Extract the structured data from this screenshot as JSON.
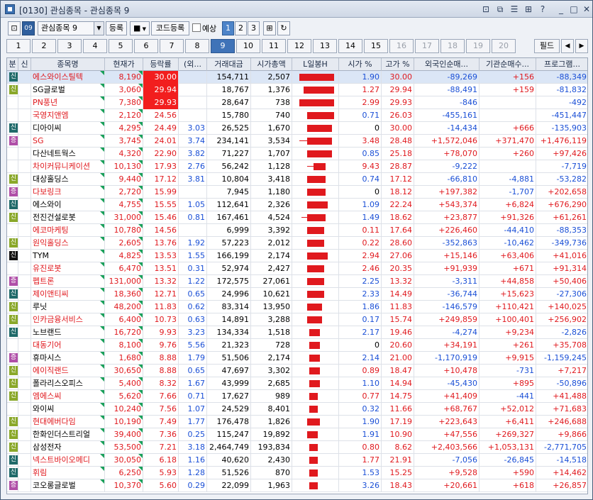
{
  "window": {
    "title": "[0130] 관심종목 - 관심종목 9",
    "buttons": [
      "⊡",
      "⧉",
      "☰",
      "⊞",
      "?",
      "_",
      "□",
      "✕"
    ]
  },
  "toolbar": {
    "icon1": "⊡",
    "icon2": "09",
    "group_value": "관심종목 9",
    "register_label": "등록",
    "square_icon": "■",
    "code_register_label": "코드등록",
    "yesang_label": "예상",
    "pages": [
      "1",
      "2",
      "3"
    ],
    "selected_page": "1",
    "tool_icon": "⊞",
    "refresh_icon": "↻"
  },
  "tabs": {
    "items": [
      "1",
      "2",
      "3",
      "4",
      "5",
      "6",
      "7",
      "8",
      "9",
      "10",
      "11",
      "12",
      "13",
      "14",
      "15",
      "16",
      "17",
      "18",
      "19",
      "20"
    ],
    "selected": "9",
    "dimmed_from": 16,
    "filter_label": "필드",
    "prev": "◀",
    "next": "▶"
  },
  "grid": {
    "headers": [
      "분",
      "신",
      "종목명",
      "현재가",
      "등락률",
      "(외...",
      "거래대금",
      "시가총액",
      "L일봉H",
      "시가 %",
      "고가 %",
      "외국인순매...",
      "기관순매수...",
      "프로그램..."
    ],
    "badge_colors": {
      "신": "#1f6a6a",
      "증": "#b04fa8",
      "신2": "#8aa82a",
      "신3": "#111111"
    },
    "rows": [
      {
        "badge": "신",
        "bt": "t",
        "name": "에스와이스틸텍",
        "nr": true,
        "price": "8,190",
        "rate": "30.00",
        "hot": true,
        "fr": "",
        "amt": "154,711",
        "cap": "2,507",
        "c": [
          0.15,
          0.95,
          0.1,
          0.95
        ],
        "open": "1.90",
        "od": "dn",
        "high": "30.00",
        "frn": "-89,269",
        "fd": "dn",
        "inst": "+156",
        "id": "up",
        "prog": "-88,349",
        "pd": "dn",
        "hl": true
      },
      {
        "badge": "신",
        "bt": "g",
        "name": "SG글로벌",
        "nr": false,
        "price": "3,060",
        "rate": "29.94",
        "hot": true,
        "fr": "",
        "amt": "18,767",
        "cap": "1,376",
        "c": [
          0.25,
          0.95,
          0.2,
          0.95
        ],
        "open": "1.27",
        "od": "up",
        "high": "29.94",
        "frn": "-88,491",
        "fd": "dn",
        "inst": "+159",
        "id": "up",
        "prog": "-81,832",
        "pd": "dn"
      },
      {
        "badge": "",
        "bt": "",
        "name": "PN풍년",
        "nr": true,
        "price": "7,380",
        "rate": "29.93",
        "hot": true,
        "fr": "",
        "amt": "28,647",
        "cap": "738",
        "c": [
          0.2,
          0.95,
          0.1,
          0.95
        ],
        "open": "2.99",
        "od": "up",
        "high": "29.93",
        "frn": "-846",
        "fd": "dn",
        "inst": "",
        "id": "up",
        "prog": "-492",
        "pd": "dn"
      },
      {
        "badge": "",
        "bt": "",
        "name": "국영지앤엠",
        "nr": true,
        "price": "2,120",
        "rate": "24.56",
        "hot": false,
        "fr": "",
        "amt": "15,780",
        "cap": "740",
        "c": [
          0.3,
          0.85,
          0.3,
          0.95
        ],
        "open": "0.71",
        "od": "dn",
        "high": "26.03",
        "frn": "-455,161",
        "fd": "dn",
        "inst": "",
        "id": "up",
        "prog": "-451,447",
        "pd": "dn"
      },
      {
        "badge": "신",
        "bt": "t",
        "name": "디아이씨",
        "nr": false,
        "price": "4,295",
        "rate": "24.49",
        "hot": false,
        "fr": "3.03",
        "amt": "26,525",
        "cap": "1,670",
        "c": [
          0.3,
          0.8,
          0.3,
          0.9
        ],
        "open": "0",
        "od": "blk",
        "high": "30.00",
        "frn": "-14,434",
        "fd": "dn",
        "inst": "+666",
        "id": "up",
        "prog": "-135,903",
        "pd": "dn"
      },
      {
        "badge": "증",
        "bt": "p",
        "name": "SG",
        "nr": true,
        "price": "3,745",
        "rate": "24.01",
        "hot": false,
        "fr": "3.74",
        "amt": "234,141",
        "cap": "3,534",
        "c": [
          0.1,
          0.8,
          0.3,
          0.9
        ],
        "open": "3.48",
        "od": "up",
        "high": "28.48",
        "frn": "+1,572,046",
        "fd": "up",
        "inst": "+371,470",
        "id": "up",
        "prog": "+1,476,119",
        "pd": "up"
      },
      {
        "badge": "",
        "bt": "",
        "name": "다산네트웍스",
        "nr": false,
        "price": "4,320",
        "rate": "22.90",
        "hot": false,
        "fr": "3.82",
        "amt": "71,227",
        "cap": "1,707",
        "c": [
          0.3,
          0.8,
          0.3,
          0.9
        ],
        "open": "0.85",
        "od": "dn",
        "high": "25.18",
        "frn": "+78,070",
        "fd": "up",
        "inst": "+260",
        "id": "up",
        "prog": "+97,426",
        "pd": "up"
      },
      {
        "badge": "",
        "bt": "",
        "name": "차이커뮤니케이션",
        "nr": true,
        "price": "10,130",
        "rate": "17.93",
        "hot": false,
        "fr": "2.76",
        "amt": "56,242",
        "cap": "1,128",
        "c": [
          0.3,
          0.6,
          0.45,
          0.75
        ],
        "open": "9.43",
        "od": "up",
        "high": "28.87",
        "frn": "-9,222",
        "fd": "dn",
        "inst": "",
        "id": "up",
        "prog": "-7,719",
        "pd": "dn"
      },
      {
        "badge": "신",
        "bt": "g",
        "name": "대상홀딩스",
        "nr": false,
        "price": "9,440",
        "rate": "17.12",
        "hot": false,
        "fr": "3.81",
        "amt": "10,804",
        "cap": "3,418",
        "c": [
          0.3,
          0.65,
          0.3,
          0.75
        ],
        "open": "0.74",
        "od": "dn",
        "high": "17.12",
        "frn": "-66,810",
        "fd": "dn",
        "inst": "-4,881",
        "id": "dn",
        "prog": "-53,282",
        "pd": "dn"
      },
      {
        "badge": "증",
        "bt": "p",
        "name": "다보링크",
        "nr": true,
        "price": "2,720",
        "rate": "15.99",
        "hot": false,
        "fr": "",
        "amt": "7,945",
        "cap": "1,180",
        "c": [
          0.3,
          0.65,
          0.3,
          0.75
        ],
        "open": "0",
        "od": "blk",
        "high": "18.12",
        "frn": "+197,382",
        "fd": "up",
        "inst": "-1,707",
        "id": "dn",
        "prog": "+202,658",
        "pd": "up"
      },
      {
        "badge": "신",
        "bt": "t",
        "name": "에스와이",
        "nr": false,
        "price": "4,755",
        "rate": "15.55",
        "hot": false,
        "fr": "1.05",
        "amt": "112,641",
        "cap": "2,326",
        "c": [
          0.3,
          0.7,
          0.3,
          0.8
        ],
        "open": "1.09",
        "od": "dn",
        "high": "22.24",
        "frn": "+543,374",
        "fd": "up",
        "inst": "+6,824",
        "id": "up",
        "prog": "+676,290",
        "pd": "up"
      },
      {
        "badge": "신",
        "bt": "g",
        "name": "전진건설로봇",
        "nr": false,
        "price": "31,000",
        "rate": "15.46",
        "hot": false,
        "fr": "0.81",
        "amt": "167,461",
        "cap": "4,524",
        "c": [
          0.15,
          0.65,
          0.3,
          0.75
        ],
        "open": "1.49",
        "od": "dn",
        "high": "18.62",
        "frn": "+23,877",
        "fd": "up",
        "inst": "+91,326",
        "id": "up",
        "prog": "+61,261",
        "pd": "up"
      },
      {
        "badge": "",
        "bt": "",
        "name": "에코마케팅",
        "nr": true,
        "price": "10,780",
        "rate": "14.56",
        "hot": false,
        "fr": "",
        "amt": "6,999",
        "cap": "3,392",
        "c": [
          0.3,
          0.6,
          0.3,
          0.7
        ],
        "open": "0.11",
        "od": "up",
        "high": "17.64",
        "frn": "+226,460",
        "fd": "up",
        "inst": "-44,410",
        "id": "dn",
        "prog": "-88,353",
        "pd": "dn"
      },
      {
        "badge": "신",
        "bt": "g",
        "name": "원익홀딩스",
        "nr": true,
        "price": "2,605",
        "rate": "13.76",
        "hot": false,
        "fr": "1.92",
        "amt": "57,223",
        "cap": "2,012",
        "c": [
          0.3,
          0.6,
          0.3,
          0.7
        ],
        "open": "0.22",
        "od": "up",
        "high": "28.60",
        "frn": "-352,863",
        "fd": "dn",
        "inst": "-10,462",
        "id": "dn",
        "prog": "-349,736",
        "pd": "dn"
      },
      {
        "badge": "신",
        "bt": "k",
        "name": "TYM",
        "nr": false,
        "price": "4,825",
        "rate": "13.53",
        "hot": false,
        "fr": "1.55",
        "amt": "166,199",
        "cap": "2,174",
        "c": [
          0.3,
          0.6,
          0.3,
          0.8
        ],
        "open": "2.94",
        "od": "up",
        "high": "27.06",
        "frn": "+15,146",
        "fd": "up",
        "inst": "+63,406",
        "id": "up",
        "prog": "+41,016",
        "pd": "up"
      },
      {
        "badge": "",
        "bt": "",
        "name": "유진로봇",
        "nr": true,
        "price": "6,470",
        "rate": "13.51",
        "hot": false,
        "fr": "0.31",
        "amt": "52,974",
        "cap": "2,427",
        "c": [
          0.3,
          0.6,
          0.3,
          0.7
        ],
        "open": "2.46",
        "od": "up",
        "high": "20.35",
        "frn": "+91,939",
        "fd": "up",
        "inst": "+671",
        "id": "up",
        "prog": "+91,314",
        "pd": "up"
      },
      {
        "badge": "증",
        "bt": "p",
        "name": "펩트론",
        "nr": true,
        "price": "131,000",
        "rate": "13.32",
        "hot": false,
        "fr": "1.22",
        "amt": "172,575",
        "cap": "27,061",
        "c": [
          0.3,
          0.55,
          0.3,
          0.7
        ],
        "open": "2.25",
        "od": "dn",
        "high": "13.32",
        "frn": "-3,311",
        "fd": "dn",
        "inst": "+44,858",
        "id": "up",
        "prog": "+50,406",
        "pd": "up"
      },
      {
        "badge": "신",
        "bt": "t",
        "name": "제이앤티씨",
        "nr": true,
        "price": "18,360",
        "rate": "12.71",
        "hot": false,
        "fr": "0.65",
        "amt": "24,996",
        "cap": "10,621",
        "c": [
          0.3,
          0.55,
          0.3,
          0.7
        ],
        "open": "2.33",
        "od": "dn",
        "high": "14.49",
        "frn": "-36,744",
        "fd": "dn",
        "inst": "+15,623",
        "id": "up",
        "prog": "-27,306",
        "pd": "dn"
      },
      {
        "badge": "신",
        "bt": "g",
        "name": "루닛",
        "nr": false,
        "price": "48,200",
        "rate": "11.83",
        "hot": false,
        "fr": "0.62",
        "amt": "83,314",
        "cap": "13,950",
        "c": [
          0.3,
          0.55,
          0.3,
          0.65
        ],
        "open": "1.86",
        "od": "dn",
        "high": "11.83",
        "frn": "-146,579",
        "fd": "dn",
        "inst": "+110,421",
        "id": "up",
        "prog": "+140,025",
        "pd": "up"
      },
      {
        "badge": "신",
        "bt": "g",
        "name": "인카금융서비스",
        "nr": true,
        "price": "6,400",
        "rate": "10.73",
        "hot": false,
        "fr": "0.63",
        "amt": "14,891",
        "cap": "3,288",
        "c": [
          0.3,
          0.5,
          0.3,
          0.65
        ],
        "open": "0.17",
        "od": "dn",
        "high": "15.74",
        "frn": "+249,859",
        "fd": "up",
        "inst": "+100,401",
        "id": "up",
        "prog": "+256,902",
        "pd": "up"
      },
      {
        "badge": "신",
        "bt": "t",
        "name": "노브랜드",
        "nr": false,
        "price": "16,720",
        "rate": "9.93",
        "hot": false,
        "fr": "3.23",
        "amt": "134,334",
        "cap": "1,518",
        "c": [
          0.35,
          0.5,
          0.35,
          0.6
        ],
        "open": "2.17",
        "od": "dn",
        "high": "19.46",
        "frn": "-4,274",
        "fd": "dn",
        "inst": "+9,234",
        "id": "up",
        "prog": "-2,826",
        "pd": "dn"
      },
      {
        "badge": "",
        "bt": "",
        "name": "대동기어",
        "nr": true,
        "price": "8,100",
        "rate": "9.76",
        "hot": false,
        "fr": "5.56",
        "amt": "21,323",
        "cap": "728",
        "c": [
          0.35,
          0.5,
          0.35,
          0.6
        ],
        "open": "0",
        "od": "blk",
        "high": "20.60",
        "frn": "+34,191",
        "fd": "up",
        "inst": "+261",
        "id": "up",
        "prog": "+35,708",
        "pd": "up"
      },
      {
        "badge": "증",
        "bt": "p",
        "name": "휴마시스",
        "nr": false,
        "price": "1,680",
        "rate": "8.88",
        "hot": false,
        "fr": "1.79",
        "amt": "51,506",
        "cap": "2,174",
        "c": [
          0.35,
          0.5,
          0.35,
          0.6
        ],
        "open": "2.14",
        "od": "dn",
        "high": "21.00",
        "frn": "-1,170,919",
        "fd": "dn",
        "inst": "+9,915",
        "id": "up",
        "prog": "-1,159,245",
        "pd": "dn"
      },
      {
        "badge": "신",
        "bt": "g",
        "name": "에이직랜드",
        "nr": true,
        "price": "30,650",
        "rate": "8.88",
        "hot": false,
        "fr": "0.65",
        "amt": "47,697",
        "cap": "3,302",
        "c": [
          0.35,
          0.5,
          0.35,
          0.6
        ],
        "open": "0.89",
        "od": "up",
        "high": "18.47",
        "frn": "+10,478",
        "fd": "up",
        "inst": "-731",
        "id": "dn",
        "prog": "+7,217",
        "pd": "up"
      },
      {
        "badge": "신",
        "bt": "g",
        "name": "폴라리스오피스",
        "nr": false,
        "price": "5,400",
        "rate": "8.32",
        "hot": false,
        "fr": "1.67",
        "amt": "43,999",
        "cap": "2,685",
        "c": [
          0.35,
          0.5,
          0.35,
          0.6
        ],
        "open": "1.10",
        "od": "dn",
        "high": "14.94",
        "frn": "-45,430",
        "fd": "dn",
        "inst": "+895",
        "id": "up",
        "prog": "-50,896",
        "pd": "dn"
      },
      {
        "badge": "신",
        "bt": "g",
        "name": "엠에스씨",
        "nr": true,
        "price": "5,620",
        "rate": "7.66",
        "hot": false,
        "fr": "0.71",
        "amt": "17,627",
        "cap": "989",
        "c": [
          0.35,
          0.5,
          0.35,
          0.55
        ],
        "open": "0.77",
        "od": "up",
        "high": "14.75",
        "frn": "+41,409",
        "fd": "up",
        "inst": "-441",
        "id": "dn",
        "prog": "+41,488",
        "pd": "up"
      },
      {
        "badge": "",
        "bt": "",
        "name": "와이씨",
        "nr": false,
        "price": "10,240",
        "rate": "7.56",
        "hot": false,
        "fr": "1.07",
        "amt": "24,529",
        "cap": "8,401",
        "c": [
          0.35,
          0.5,
          0.35,
          0.55
        ],
        "open": "0.32",
        "od": "dn",
        "high": "11.66",
        "frn": "+68,767",
        "fd": "up",
        "inst": "+52,012",
        "id": "up",
        "prog": "+71,683",
        "pd": "up"
      },
      {
        "badge": "신",
        "bt": "g",
        "name": "현대에버다임",
        "nr": true,
        "price": "10,190",
        "rate": "7.49",
        "hot": false,
        "fr": "1.77",
        "amt": "176,478",
        "cap": "1,826",
        "c": [
          0.3,
          0.5,
          0.3,
          0.6
        ],
        "open": "1.90",
        "od": "dn",
        "high": "17.19",
        "frn": "+223,643",
        "fd": "up",
        "inst": "+6,411",
        "id": "up",
        "prog": "+246,688",
        "pd": "up"
      },
      {
        "badge": "신",
        "bt": "g",
        "name": "한화인더스트리얼",
        "nr": false,
        "price": "39,400",
        "rate": "7.36",
        "hot": false,
        "fr": "0.25",
        "amt": "115,247",
        "cap": "19,892",
        "c": [
          0.3,
          0.5,
          0.3,
          0.55
        ],
        "open": "1.91",
        "od": "dn",
        "high": "10.90",
        "frn": "+47,556",
        "fd": "up",
        "inst": "+269,327",
        "id": "up",
        "prog": "+9,866",
        "pd": "up"
      },
      {
        "badge": "신",
        "bt": "g",
        "name": "삼성전자",
        "nr": false,
        "price": "53,500",
        "rate": "7.21",
        "hot": false,
        "fr": "3.18",
        "amt": "2,464,749",
        "cap": "193,834",
        "c": [
          0.35,
          0.5,
          0.35,
          0.55
        ],
        "open": "0.80",
        "od": "up",
        "high": "8.62",
        "frn": "+2,403,566",
        "fd": "up",
        "inst": "+1,053,131",
        "id": "up",
        "prog": "-2,771,705",
        "pd": "dn"
      },
      {
        "badge": "신",
        "bt": "t",
        "name": "넥스트바이오메디",
        "nr": true,
        "price": "30,050",
        "rate": "6.18",
        "hot": false,
        "fr": "1.16",
        "amt": "40,620",
        "cap": "2,430",
        "c": [
          0.35,
          0.45,
          0.35,
          0.55
        ],
        "open": "1.77",
        "od": "up",
        "high": "21.91",
        "frn": "-7,056",
        "fd": "dn",
        "inst": "-26,845",
        "id": "dn",
        "prog": "-14,518",
        "pd": "dn"
      },
      {
        "badge": "신",
        "bt": "t",
        "name": "휘림",
        "nr": true,
        "price": "6,250",
        "rate": "5.93",
        "hot": false,
        "fr": "1.28",
        "amt": "51,526",
        "cap": "870",
        "c": [
          0.35,
          0.45,
          0.35,
          0.55
        ],
        "open": "1.53",
        "od": "dn",
        "high": "15.25",
        "frn": "+9,528",
        "fd": "up",
        "inst": "+590",
        "id": "up",
        "prog": "+14,462",
        "pd": "up"
      },
      {
        "badge": "증",
        "bt": "p",
        "name": "코오롱글로벌",
        "nr": false,
        "price": "10,370",
        "rate": "5.60",
        "hot": false,
        "fr": "0.29",
        "amt": "22,099",
        "cap": "1,963",
        "c": [
          0.35,
          0.45,
          0.35,
          0.55
        ],
        "open": "3.26",
        "od": "dn",
        "high": "18.43",
        "frn": "+20,661",
        "fd": "up",
        "inst": "+618",
        "id": "up",
        "prog": "+26,857",
        "pd": "up"
      }
    ]
  }
}
